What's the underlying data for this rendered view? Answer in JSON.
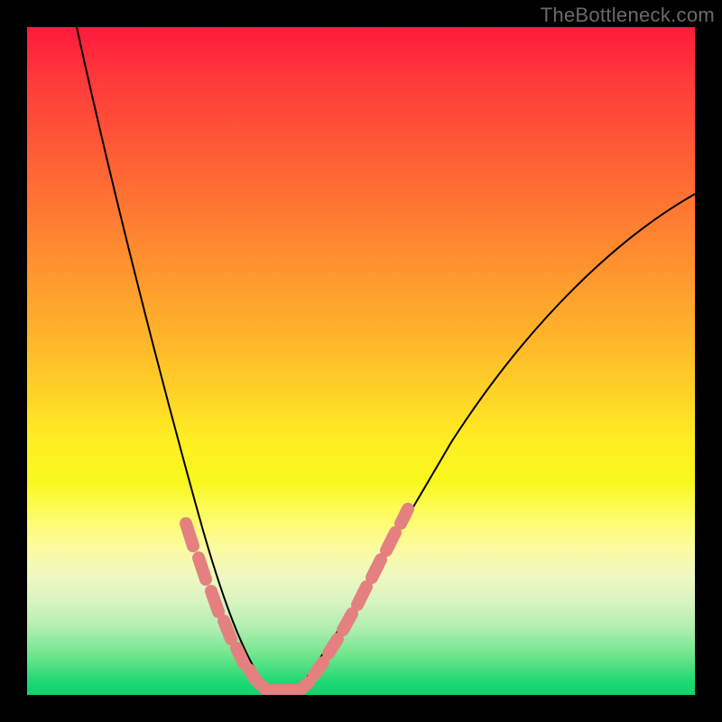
{
  "watermark": "TheBottleneck.com",
  "colors": {
    "frame": "#000000",
    "curve": "#000000",
    "dots": "#e58080",
    "gradient_top": "#ff1a3c",
    "gradient_bottom": "#0ed36a"
  },
  "chart_data": {
    "type": "line",
    "title": "",
    "xlabel": "",
    "ylabel": "",
    "xlim": [
      0,
      100
    ],
    "ylim": [
      0,
      100
    ],
    "grid": false,
    "legend": false,
    "left_curve": {
      "x": [
        8,
        10,
        12,
        14,
        16,
        18,
        20,
        22,
        24,
        26,
        28,
        30,
        32,
        34
      ],
      "y": [
        100,
        88,
        76,
        65,
        55,
        46,
        38,
        31,
        24,
        18,
        13,
        8,
        4,
        1
      ]
    },
    "right_curve": {
      "x": [
        40,
        44,
        48,
        52,
        56,
        60,
        64,
        68,
        72,
        76,
        80,
        84,
        88,
        92,
        96,
        100
      ],
      "y": [
        1,
        4,
        8,
        13,
        18,
        24,
        30,
        36,
        42,
        48,
        53,
        58,
        63,
        67,
        71,
        75
      ]
    },
    "highlight_dots_left": {
      "x": [
        23,
        25,
        27,
        29,
        31,
        33,
        35,
        37
      ],
      "y": [
        25,
        20,
        15,
        11,
        7,
        4,
        2,
        1
      ]
    },
    "highlight_dots_right": {
      "x": [
        39,
        41,
        43,
        45,
        47,
        49,
        51,
        53
      ],
      "y": [
        1,
        2,
        4,
        7,
        11,
        15,
        20,
        25
      ]
    },
    "notes": "Axes unlabeled; values estimated from pixel positions relative to a 0–100 scale on both axes. The curve is a V-shaped bottleneck curve: left branch descends steeply from top-left to a minimum near x≈37, right branch rises more gently toward upper right. Pink rounded dot-strokes highlight the lower portions of both branches near the minimum."
  }
}
